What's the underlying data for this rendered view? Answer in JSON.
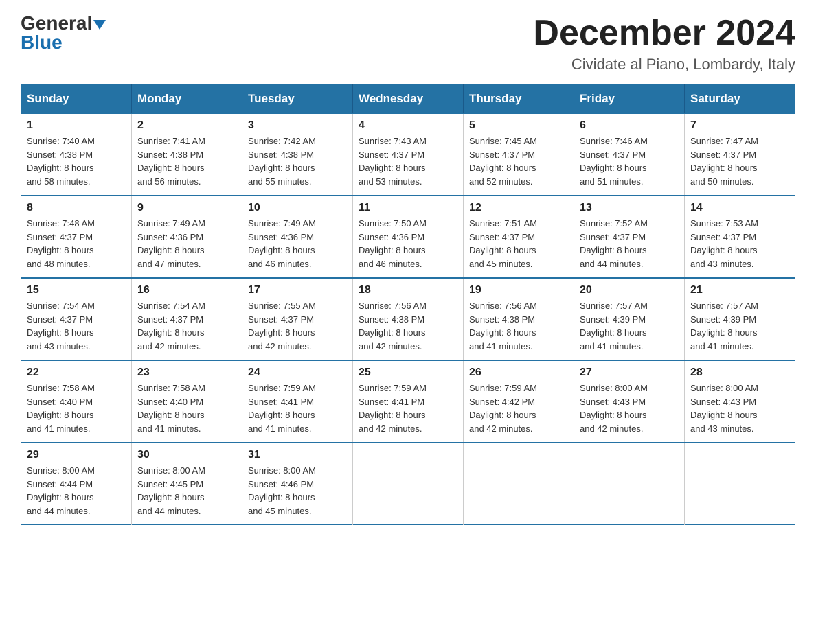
{
  "header": {
    "logo_general": "General",
    "logo_blue": "Blue",
    "month_title": "December 2024",
    "location": "Cividate al Piano, Lombardy, Italy"
  },
  "days_of_week": [
    "Sunday",
    "Monday",
    "Tuesday",
    "Wednesday",
    "Thursday",
    "Friday",
    "Saturday"
  ],
  "weeks": [
    [
      {
        "day": "1",
        "sunrise": "7:40 AM",
        "sunset": "4:38 PM",
        "daylight": "8 hours and 58 minutes."
      },
      {
        "day": "2",
        "sunrise": "7:41 AM",
        "sunset": "4:38 PM",
        "daylight": "8 hours and 56 minutes."
      },
      {
        "day": "3",
        "sunrise": "7:42 AM",
        "sunset": "4:38 PM",
        "daylight": "8 hours and 55 minutes."
      },
      {
        "day": "4",
        "sunrise": "7:43 AM",
        "sunset": "4:37 PM",
        "daylight": "8 hours and 53 minutes."
      },
      {
        "day": "5",
        "sunrise": "7:45 AM",
        "sunset": "4:37 PM",
        "daylight": "8 hours and 52 minutes."
      },
      {
        "day": "6",
        "sunrise": "7:46 AM",
        "sunset": "4:37 PM",
        "daylight": "8 hours and 51 minutes."
      },
      {
        "day": "7",
        "sunrise": "7:47 AM",
        "sunset": "4:37 PM",
        "daylight": "8 hours and 50 minutes."
      }
    ],
    [
      {
        "day": "8",
        "sunrise": "7:48 AM",
        "sunset": "4:37 PM",
        "daylight": "8 hours and 48 minutes."
      },
      {
        "day": "9",
        "sunrise": "7:49 AM",
        "sunset": "4:36 PM",
        "daylight": "8 hours and 47 minutes."
      },
      {
        "day": "10",
        "sunrise": "7:49 AM",
        "sunset": "4:36 PM",
        "daylight": "8 hours and 46 minutes."
      },
      {
        "day": "11",
        "sunrise": "7:50 AM",
        "sunset": "4:36 PM",
        "daylight": "8 hours and 46 minutes."
      },
      {
        "day": "12",
        "sunrise": "7:51 AM",
        "sunset": "4:37 PM",
        "daylight": "8 hours and 45 minutes."
      },
      {
        "day": "13",
        "sunrise": "7:52 AM",
        "sunset": "4:37 PM",
        "daylight": "8 hours and 44 minutes."
      },
      {
        "day": "14",
        "sunrise": "7:53 AM",
        "sunset": "4:37 PM",
        "daylight": "8 hours and 43 minutes."
      }
    ],
    [
      {
        "day": "15",
        "sunrise": "7:54 AM",
        "sunset": "4:37 PM",
        "daylight": "8 hours and 43 minutes."
      },
      {
        "day": "16",
        "sunrise": "7:54 AM",
        "sunset": "4:37 PM",
        "daylight": "8 hours and 42 minutes."
      },
      {
        "day": "17",
        "sunrise": "7:55 AM",
        "sunset": "4:37 PM",
        "daylight": "8 hours and 42 minutes."
      },
      {
        "day": "18",
        "sunrise": "7:56 AM",
        "sunset": "4:38 PM",
        "daylight": "8 hours and 42 minutes."
      },
      {
        "day": "19",
        "sunrise": "7:56 AM",
        "sunset": "4:38 PM",
        "daylight": "8 hours and 41 minutes."
      },
      {
        "day": "20",
        "sunrise": "7:57 AM",
        "sunset": "4:39 PM",
        "daylight": "8 hours and 41 minutes."
      },
      {
        "day": "21",
        "sunrise": "7:57 AM",
        "sunset": "4:39 PM",
        "daylight": "8 hours and 41 minutes."
      }
    ],
    [
      {
        "day": "22",
        "sunrise": "7:58 AM",
        "sunset": "4:40 PM",
        "daylight": "8 hours and 41 minutes."
      },
      {
        "day": "23",
        "sunrise": "7:58 AM",
        "sunset": "4:40 PM",
        "daylight": "8 hours and 41 minutes."
      },
      {
        "day": "24",
        "sunrise": "7:59 AM",
        "sunset": "4:41 PM",
        "daylight": "8 hours and 41 minutes."
      },
      {
        "day": "25",
        "sunrise": "7:59 AM",
        "sunset": "4:41 PM",
        "daylight": "8 hours and 42 minutes."
      },
      {
        "day": "26",
        "sunrise": "7:59 AM",
        "sunset": "4:42 PM",
        "daylight": "8 hours and 42 minutes."
      },
      {
        "day": "27",
        "sunrise": "8:00 AM",
        "sunset": "4:43 PM",
        "daylight": "8 hours and 42 minutes."
      },
      {
        "day": "28",
        "sunrise": "8:00 AM",
        "sunset": "4:43 PM",
        "daylight": "8 hours and 43 minutes."
      }
    ],
    [
      {
        "day": "29",
        "sunrise": "8:00 AM",
        "sunset": "4:44 PM",
        "daylight": "8 hours and 44 minutes."
      },
      {
        "day": "30",
        "sunrise": "8:00 AM",
        "sunset": "4:45 PM",
        "daylight": "8 hours and 44 minutes."
      },
      {
        "day": "31",
        "sunrise": "8:00 AM",
        "sunset": "4:46 PM",
        "daylight": "8 hours and 45 minutes."
      },
      null,
      null,
      null,
      null
    ]
  ],
  "labels": {
    "sunrise": "Sunrise:",
    "sunset": "Sunset:",
    "daylight": "Daylight:"
  }
}
